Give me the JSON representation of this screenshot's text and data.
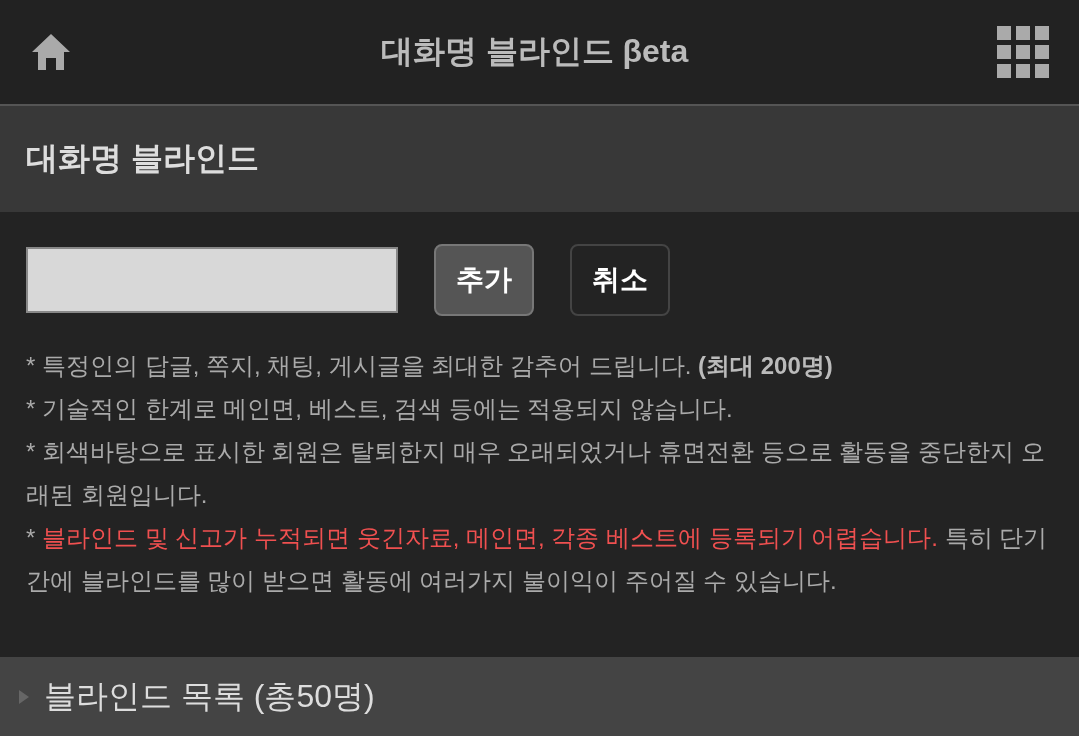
{
  "top_bar": {
    "title": "대화명 블라인드 βeta"
  },
  "section": {
    "title": "대화명 블라인드"
  },
  "form": {
    "buttons": [
      {
        "label": "추가",
        "kind": "primary"
      },
      {
        "label": "취소",
        "kind": "secondary"
      }
    ]
  },
  "notes": [
    {
      "segments": [
        {
          "text": "* 특정인의 답글, 쪽지, 채팅, 게시글을 최대한 감추어 드립니다. **(최대 200명)**",
          "kind": "plain"
        }
      ]
    },
    {
      "segments": [
        {
          "text": "* 기술적인 한계로 메인면, 베스트, 검색 등에는 적용되지 않습니다.",
          "kind": "plain"
        }
      ]
    },
    {
      "segments": [
        {
          "text": "* 회색바탕으로 표시한 회원은 탈퇴한지 매우 오래되었거나 휴면전환 등으로 활동을 중단한지 오래된 회원입니다.",
          "kind": "plain"
        }
      ]
    },
    {
      "segments": [
        {
          "text": "* ",
          "kind": "plain"
        },
        {
          "text": "블라인드 및 신고가 누적되면 웃긴자료, 메인면, 각종 베스트에 등록되기 어렵습니다.",
          "kind": "alert"
        },
        {
          "text": " 특히 단기간에 블라인드를 많이 받으면 활동에 여러가지 불이익이 주어질 수 있습니다.",
          "kind": "plain"
        }
      ]
    }
  ],
  "blind_list": {
    "title": "블라인드 목록 (총50명)",
    "expanded": false
  }
}
